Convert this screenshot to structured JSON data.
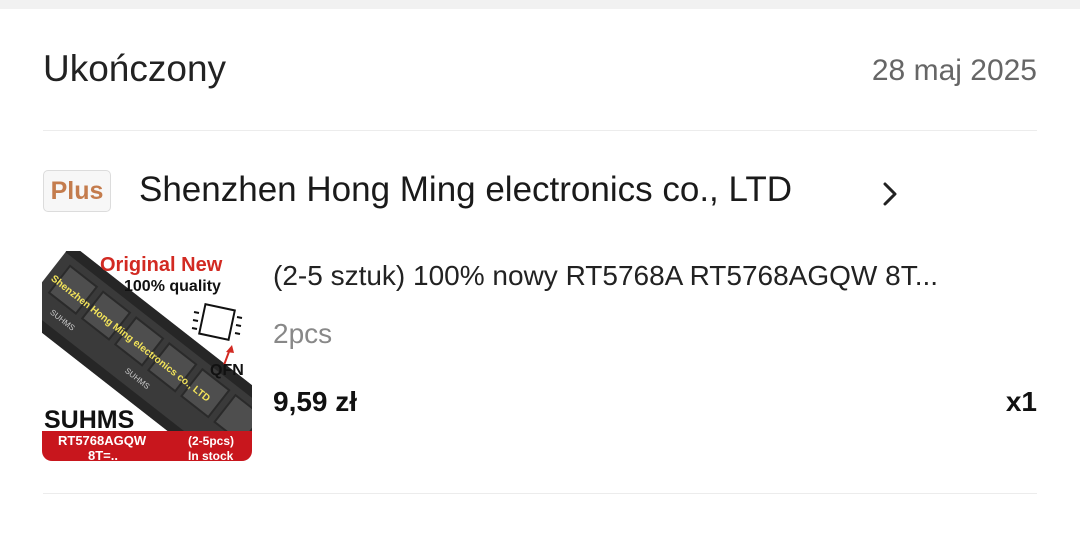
{
  "order": {
    "status": "Ukończony",
    "date": "28 maj 2025"
  },
  "store": {
    "badge": "Plus",
    "name": "Shenzhen Hong Ming electronics co., LTD",
    "chevron_icon": "chevron-right-icon"
  },
  "item": {
    "title": "(2-5 sztuk) 100% nowy RT5768A RT5768AGQW 8T...",
    "variant": "2pcs",
    "price": "9,59 zł",
    "quantity": "x1",
    "image": {
      "headline": "Original New",
      "quality": "100% quality",
      "package": "QFN",
      "diagonal": "Shenzhen Hong Ming electronics co., LTD",
      "brand": "SUHMS",
      "part": "RT5768AGQW",
      "code": "8T=..",
      "pack": "(2-5pcs)",
      "stock": "In stock",
      "chip_mark": "SUHMS"
    }
  }
}
